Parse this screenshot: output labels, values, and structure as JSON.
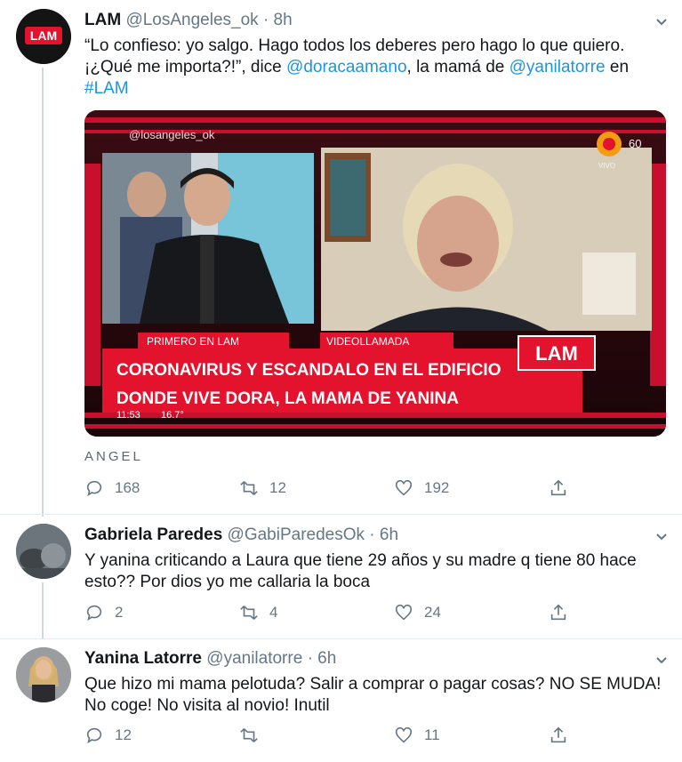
{
  "tweets": [
    {
      "name": "LAM",
      "handle": "@LosAngeles_ok",
      "time": "8h",
      "avatar_logo": "LAM",
      "text": {
        "part1": "“Lo confieso: yo salgo. Hago todos los deberes pero hago lo que quiero. ¡¿Qué me importa?!”, dice ",
        "mention1": "@doracaamano",
        "part2": ", la mamá de ",
        "mention2": "@yanilatorre",
        "part3": " en",
        "hashtag": "#LAM"
      },
      "media": {
        "watermark": "@losangeles_ok",
        "channel": "60",
        "live": "VIVO",
        "tag1": "PRIMERO EN LAM",
        "tag2": "VIDEOLLAMADA",
        "headline1": "CORONAVIRUS Y ESCANDALO EN EL EDIFICIO",
        "headline2": "DONDE VIVE DORA, LA MAMA DE YANINA",
        "clock": "11:53",
        "temp": "16.7°",
        "logo": "LAM",
        "credit": "ANGEL"
      },
      "replies": "168",
      "retweets": "12",
      "likes": "192"
    },
    {
      "name": "Gabriela Paredes",
      "handle": "@GabiParedesOk",
      "time": "6h",
      "text": "Y yanina criticando a Laura que tiene 29 años y su madre q tiene 80 hace esto?? Por dios yo me callaria la boca",
      "replies": "2",
      "retweets": "4",
      "likes": "24"
    },
    {
      "name": "Yanina Latorre",
      "handle": "@yanilatorre",
      "time": "6h",
      "text": "Que hizo mi mama pelotuda? Salir a comprar o pagar cosas? NO SE MUDA! No coge! No visita al novio! Inutil",
      "replies": "12",
      "retweets": "",
      "likes": "11"
    }
  ],
  "colors": {
    "link": "#1b95e0",
    "meta": "#657786",
    "lam_red": "#e3122d"
  },
  "separator": "·"
}
